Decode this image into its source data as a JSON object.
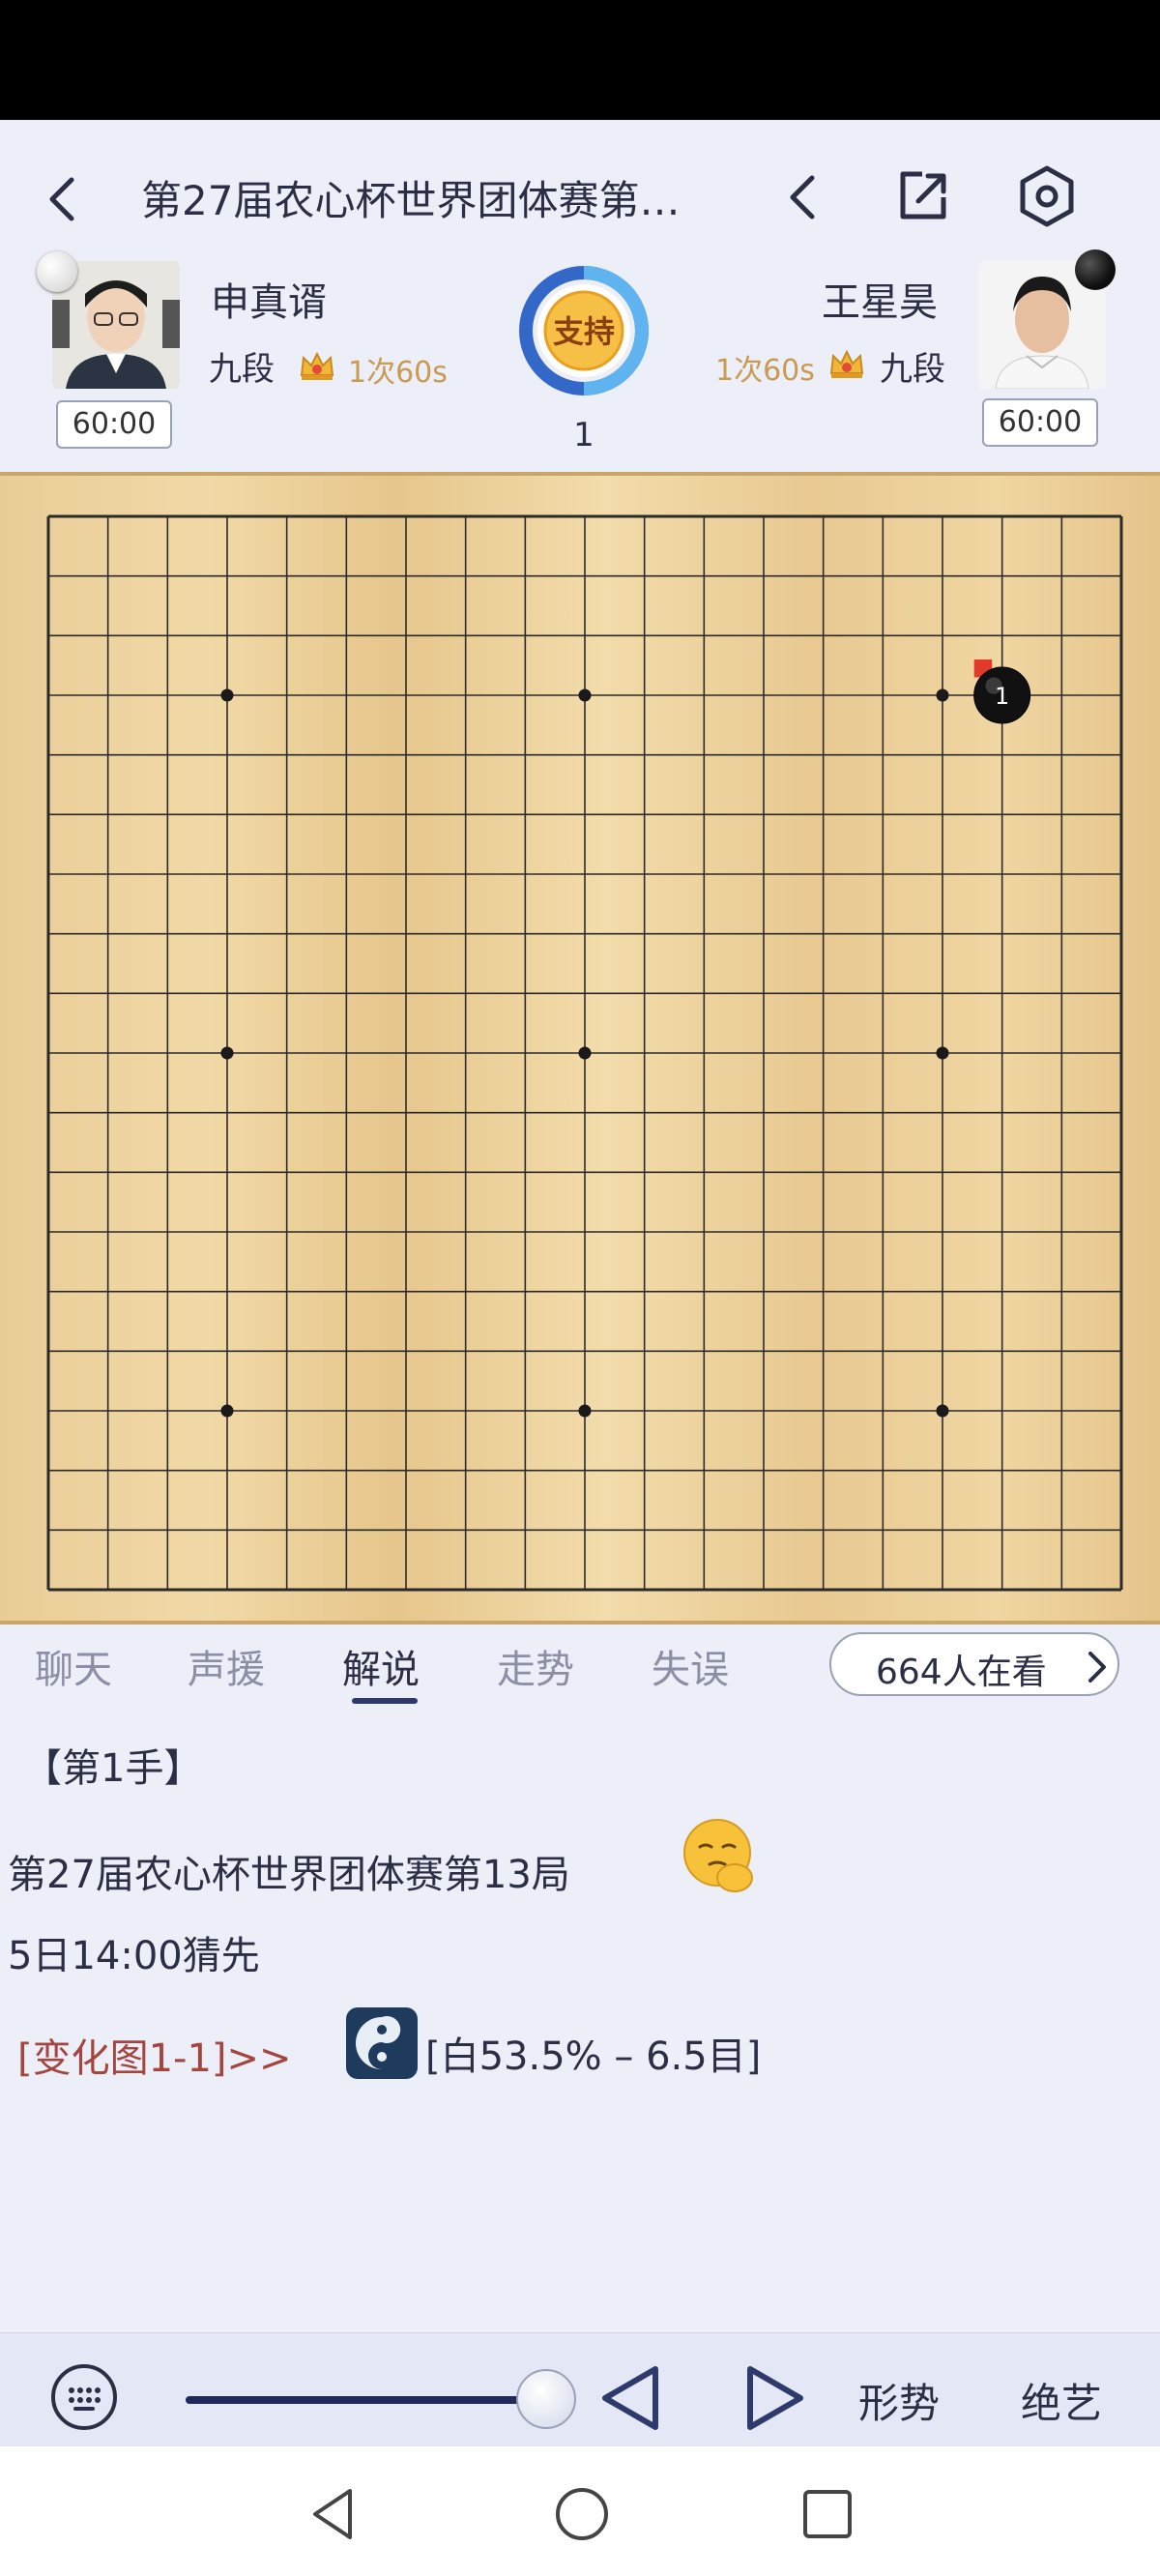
{
  "header": {
    "title": "第27届农心杯世界团体赛第…",
    "back_icon": "chevron-left-icon",
    "prev_icon": "chevron-left-icon",
    "share_icon": "share-icon",
    "settings_icon": "settings-hexagon-icon"
  },
  "players": {
    "white": {
      "name": "申真谞",
      "rank": "九段",
      "byoyomi": "1次60s",
      "clock": "60:00",
      "stone": "white"
    },
    "black": {
      "name": "王星昊",
      "rank": "九段",
      "byoyomi": "1次60s",
      "clock": "60:00",
      "stone": "black"
    }
  },
  "support": {
    "label": "支持",
    "ring_split": 0.5
  },
  "move_number": "1",
  "board": {
    "size": 19,
    "stones": [
      {
        "color": "black",
        "col": 16,
        "row": 3,
        "label": "1",
        "last_move": true
      }
    ],
    "colors": {
      "grid": "#2a2a2a",
      "wood": "#ecd29d"
    }
  },
  "tabs": [
    {
      "label": "聊天",
      "active": false
    },
    {
      "label": "声援",
      "active": false
    },
    {
      "label": "解说",
      "active": true
    },
    {
      "label": "走势",
      "active": false
    },
    {
      "label": "失误",
      "active": false
    }
  ],
  "viewers": {
    "label": "664人在看"
  },
  "commentary": {
    "move_header": "【第1手】",
    "event_line": "第27届农心杯世界团体赛第13局",
    "time_line": "5日14:00猜先",
    "variation_link": "[变化图1-1]>>",
    "winrate": "[白53.5% – 6.5目]"
  },
  "controls": {
    "keyboard_icon": "keyboard-icon",
    "slider_value": 1.0,
    "prev_icon": "triangle-left-icon",
    "next_icon": "triangle-right-icon",
    "shape_label": "形势",
    "ai_label": "绝艺"
  },
  "system_nav": {
    "back": "nav-back-icon",
    "home": "nav-home-icon",
    "recents": "nav-recents-icon"
  }
}
